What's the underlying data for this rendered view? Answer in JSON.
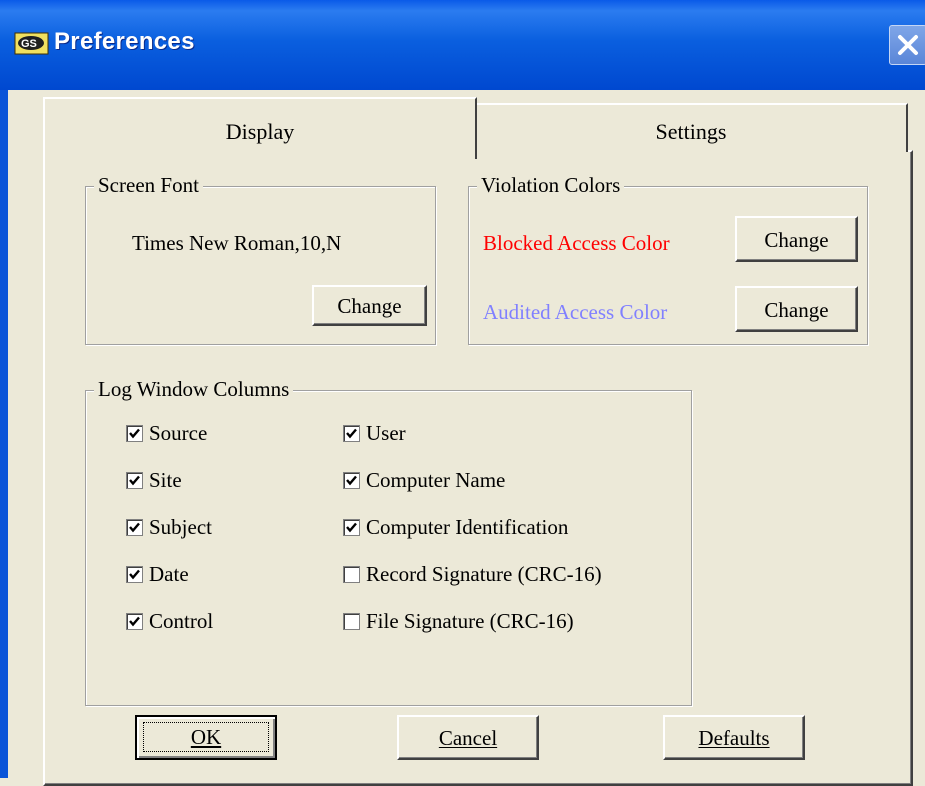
{
  "window": {
    "title": "Preferences"
  },
  "tabs": [
    {
      "label": "Display",
      "active": true
    },
    {
      "label": "Settings",
      "active": false
    }
  ],
  "screen_font": {
    "legend": "Screen Font",
    "value": "Times New Roman,10,N",
    "change_label": "Change"
  },
  "violation_colors": {
    "legend": "Violation Colors",
    "blocked": {
      "label": "Blocked Access Color",
      "color": "#ff0000",
      "change_label": "Change"
    },
    "audited": {
      "label": "Audited Access Color",
      "color": "#8080ff",
      "change_label": "Change"
    }
  },
  "log_columns": {
    "legend": "Log Window Columns",
    "items": [
      {
        "label": "Source",
        "checked": true
      },
      {
        "label": "Site",
        "checked": true
      },
      {
        "label": "Subject",
        "checked": true
      },
      {
        "label": "Date",
        "checked": true
      },
      {
        "label": "Control",
        "checked": true
      },
      {
        "label": "User",
        "checked": true
      },
      {
        "label": "Computer Name",
        "checked": true
      },
      {
        "label": "Computer Identification",
        "checked": true
      },
      {
        "label": "Record Signature (CRC-16)",
        "checked": false
      },
      {
        "label": "File Signature (CRC-16)",
        "checked": false
      }
    ]
  },
  "footer": {
    "ok_label": "OK",
    "cancel_label": "Cancel",
    "defaults_label": "Defaults"
  }
}
